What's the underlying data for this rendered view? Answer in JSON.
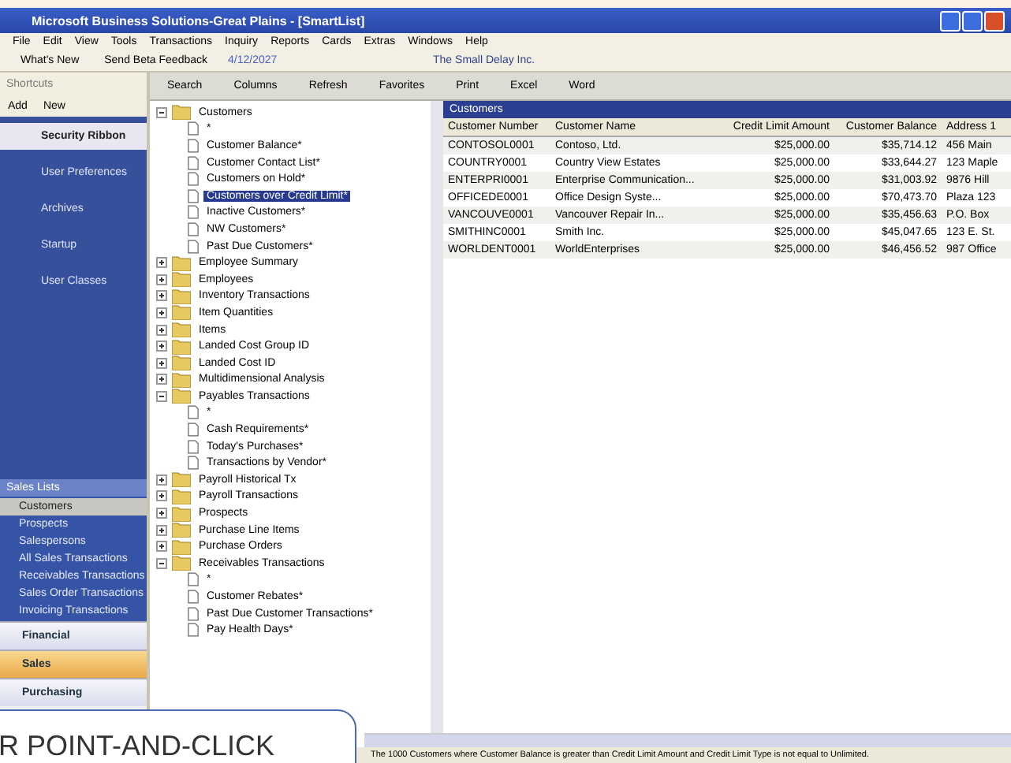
{
  "window": {
    "title": "Microsoft Business Solutions-Great Plains - [SmartList]"
  },
  "menu": [
    "File",
    "Edit",
    "View",
    "Tools",
    "Transactions",
    "Inquiry",
    "Reports",
    "Cards",
    "Extras",
    "Windows",
    "Help"
  ],
  "toolbar": {
    "items": [
      "What's New",
      "Send Beta Feedback"
    ],
    "date": "4/12/2027",
    "company": "The Small Delay Inc."
  },
  "navigation": {
    "title": "Shortcuts",
    "actions": [
      "Add",
      "New"
    ],
    "shortcuts": [
      {
        "label": "Security Ribbon",
        "selected": true
      },
      {
        "label": "User Preferences",
        "selected": false
      },
      {
        "label": "Archives",
        "selected": false
      },
      {
        "label": "Startup",
        "selected": false
      },
      {
        "label": "User Classes",
        "selected": false
      }
    ],
    "lists_title": "Sales Lists",
    "lists": [
      {
        "label": "Customers",
        "selected": true
      },
      {
        "label": "Prospects",
        "selected": false
      },
      {
        "label": "Salespersons",
        "selected": false
      },
      {
        "label": "All Sales Transactions",
        "selected": false
      },
      {
        "label": "Receivables Transactions",
        "selected": false
      },
      {
        "label": "Sales Order Transactions",
        "selected": false
      },
      {
        "label": "Invoicing Transactions",
        "selected": false
      }
    ],
    "modules": [
      {
        "label": "Financial",
        "selected": false
      },
      {
        "label": "Sales",
        "selected": true
      },
      {
        "label": "Purchasing",
        "selected": false
      }
    ]
  },
  "smartlist_toolbar": [
    "Search",
    "Columns",
    "Refresh",
    "Favorites",
    "Print",
    "Excel",
    "Word"
  ],
  "tree": [
    {
      "label": "Customers",
      "expanded": true,
      "children": [
        {
          "label": "*",
          "selected": false
        },
        {
          "label": "Customer Balance*",
          "selected": false
        },
        {
          "label": "Customer Contact List*",
          "selected": false
        },
        {
          "label": "Customers on Hold*",
          "selected": false
        },
        {
          "label": "Customers over Credit Limit*",
          "selected": true
        },
        {
          "label": "Inactive Customers*",
          "selected": false
        },
        {
          "label": "NW Customers*",
          "selected": false
        },
        {
          "label": "Past Due Customers*",
          "selected": false
        }
      ]
    },
    {
      "label": "Employee Summary",
      "expanded": false
    },
    {
      "label": "Employees",
      "expanded": false
    },
    {
      "label": "Inventory Transactions",
      "expanded": false
    },
    {
      "label": "Item Quantities",
      "expanded": false
    },
    {
      "label": "Items",
      "expanded": false
    },
    {
      "label": "Landed Cost Group ID",
      "expanded": false
    },
    {
      "label": "Landed Cost ID",
      "expanded": false
    },
    {
      "label": "Multidimensional Analysis",
      "expanded": false
    },
    {
      "label": "Payables Transactions",
      "expanded": true,
      "children": [
        {
          "label": "*",
          "selected": false
        },
        {
          "label": "Cash Requirements*",
          "selected": false
        },
        {
          "label": "Today's Purchases*",
          "selected": false
        },
        {
          "label": "Transactions by Vendor*",
          "selected": false
        }
      ]
    },
    {
      "label": "Payroll Historical Tx",
      "expanded": false
    },
    {
      "label": "Payroll Transactions",
      "expanded": false
    },
    {
      "label": "Prospects",
      "expanded": false
    },
    {
      "label": "Purchase Line Items",
      "expanded": false
    },
    {
      "label": "Purchase Orders",
      "expanded": false
    },
    {
      "label": "Receivables Transactions",
      "expanded": true,
      "children": [
        {
          "label": "*",
          "selected": false
        },
        {
          "label": "Customer Rebates*",
          "selected": false
        },
        {
          "label": "Past Due Customer Transactions*",
          "selected": false
        },
        {
          "label": "Pay Health Days*",
          "selected": false
        }
      ]
    }
  ],
  "grid": {
    "title": "Customers",
    "columns": [
      "Customer Number",
      "Customer Name",
      "Credit Limit Amount",
      "Customer Balance",
      "Address 1"
    ],
    "rows": [
      [
        "CONTOSOL0001",
        "Contoso, Ltd.",
        "$25,000.00",
        "$35,714.12",
        "456 Main"
      ],
      [
        "COUNTRY0001",
        "Country View Estates",
        "$25,000.00",
        "$33,644.27",
        "123 Maple"
      ],
      [
        "ENTERPRI0001",
        "Enterprise Communication...",
        "$25,000.00",
        "$31,003.92",
        "9876 Hill"
      ],
      [
        "OFFICEDE0001",
        "Office Design Syste...",
        "$25,000.00",
        "$70,473.70",
        "Plaza 123"
      ],
      [
        "VANCOUVE0001",
        "Vancouver Repair In...",
        "$25,000.00",
        "$35,456.63",
        "P.O. Box"
      ],
      [
        "SMITHINC0001",
        "Smith Inc.",
        "$25,000.00",
        "$45,047.65",
        "123 E. St."
      ],
      [
        "WORLDENT0001",
        "WorldEnterprises",
        "$25,000.00",
        "$46,456.52",
        "987 Office"
      ]
    ]
  },
  "status_bar": "The 1000 Customers where Customer Balance is greater than Credit Limit Amount and Credit Limit Type is not equal to Unlimited.",
  "callout": "R POINT-AND-CLICK"
}
